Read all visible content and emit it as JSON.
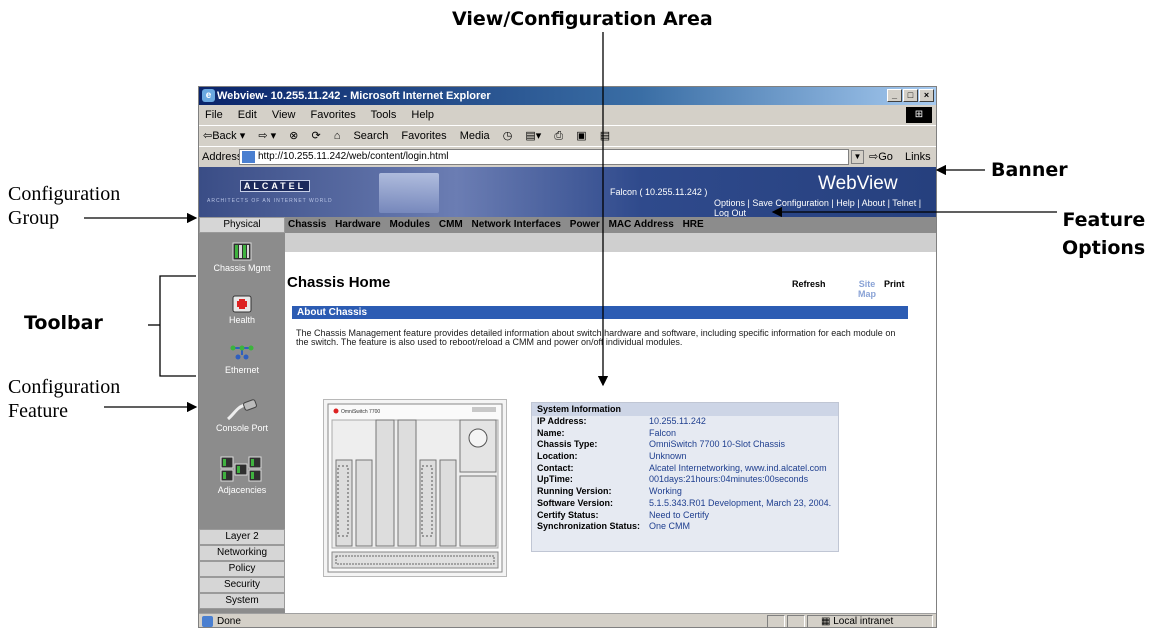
{
  "annotations": {
    "view_area": "View/Configuration Area",
    "banner": "Banner",
    "feature_options_1": "Feature",
    "feature_options_2": "Options",
    "toolbar": "Toolbar",
    "config_group_1": "Configuration",
    "config_group_2": "Group",
    "config_feature_1": "Configuration",
    "config_feature_2": "Feature"
  },
  "browser": {
    "title": "Webview- 10.255.11.242 - Microsoft Internet Explorer",
    "menu": [
      "File",
      "Edit",
      "View",
      "Favorites",
      "Tools",
      "Help"
    ],
    "toolbar": [
      "⇦Back ▾",
      "⇨ ▾",
      "⊗",
      "⟳",
      "⌂",
      "Search",
      "Favorites",
      "Media",
      "◷",
      "▤▾",
      "⎙",
      "▣",
      "▤"
    ],
    "address_label": "Address",
    "url": "http://10.255.11.242/web/content/login.html",
    "go": "Go",
    "links": "Links »",
    "status": "Done",
    "zone": "Local intranet"
  },
  "webview": {
    "logo": "ALCATEL",
    "tagline": "ARCHITECTS OF AN INTERNET WORLD",
    "host": "Falcon  ( 10.255.11.242 )",
    "app_title": "WebView",
    "banner_links": "Options  |  Save Configuration  |  Help  |  About  |  Telnet  |  Log Out",
    "current_group": "Physical",
    "feature_options": [
      "Chassis",
      "Hardware",
      "Modules",
      "CMM",
      "Network Interfaces",
      "Power",
      "MAC Address",
      "HRE"
    ],
    "tools": [
      "Chassis Mgmt",
      "Health",
      "Ethernet",
      "Console Port",
      "Adjacencies"
    ],
    "groups": [
      "Layer 2",
      "Networking",
      "Policy",
      "Security",
      "System"
    ]
  },
  "content": {
    "title": "Chassis Home",
    "actions": {
      "refresh": "Refresh",
      "site_map": "Site Map",
      "print": "Print"
    },
    "section": "About Chassis",
    "description": "The Chassis Management feature provides detailed information about switch hardware and software, including specific information for each module on the switch. The feature is also used to reboot/reload a CMM and power on/off individual modules.",
    "chassis_label": "OmniSwitch 7700",
    "system_info": {
      "header": "System Information",
      "rows": [
        {
          "label": "IP Address:",
          "value": "10.255.11.242"
        },
        {
          "label": "Name:",
          "value": "Falcon"
        },
        {
          "label": "Chassis Type:",
          "value": "OmniSwitch 7700 10-Slot Chassis"
        },
        {
          "label": "Location:",
          "value": "Unknown"
        },
        {
          "label": "Contact:",
          "value": "Alcatel Internetworking, www.ind.alcatel.com"
        },
        {
          "label": "UpTime:",
          "value": "001days:21hours:04minutes:00seconds"
        },
        {
          "label": "Running Version:",
          "value": "Working"
        },
        {
          "label": "Software Version:",
          "value": "5.1.5.343.R01 Development, March 23, 2004."
        },
        {
          "label": "Certify Status:",
          "value": "Need to Certify"
        },
        {
          "label": "Synchronization Status:",
          "value": "One CMM"
        }
      ]
    }
  },
  "colors": {
    "banner": "#2f4a8c",
    "section_bar": "#2c5cb3",
    "toolbar_bg": "#8c8c8c",
    "info_value": "#1f3f8f"
  }
}
